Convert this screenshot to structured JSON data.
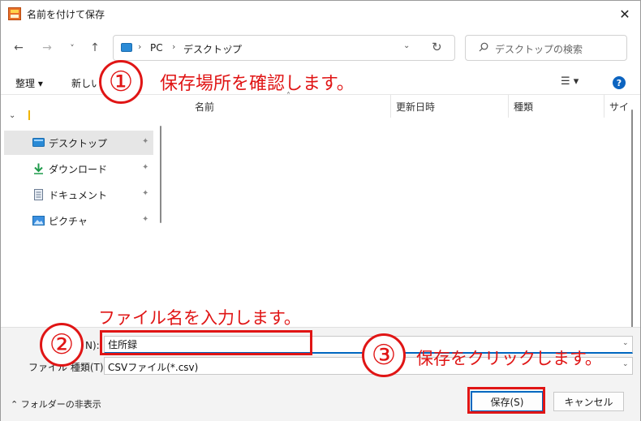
{
  "window": {
    "title": "名前を付けて保存",
    "close_glyph": "✕"
  },
  "nav": {
    "back_glyph": "←",
    "forward_glyph": "→",
    "recent_glyph": "˅",
    "up_glyph": "↑",
    "address": {
      "sep": "›",
      "crumbs": [
        "PC",
        "デスクトップ"
      ],
      "dropdown_glyph": "⌄",
      "refresh_glyph": "↻"
    },
    "search_placeholder": "デスクトップの検索"
  },
  "commandbar": {
    "organize_label": "整理 ▾",
    "newfolder_label": "新しい",
    "view_glyph": "☰ ▾",
    "help_glyph": "?"
  },
  "navpane": {
    "expand_glyph": "⌄",
    "pin_glyph": "📌",
    "items": [
      {
        "label": "デスクトップ",
        "icon": "desktop-icon"
      },
      {
        "label": "ダウンロード",
        "icon": "download-icon"
      },
      {
        "label": "ドキュメント",
        "icon": "document-icon"
      },
      {
        "label": "ピクチャ",
        "icon": "picture-icon"
      }
    ]
  },
  "filelist": {
    "sort_glyph": "˄",
    "columns": [
      "名前",
      "更新日時",
      "種類",
      "サイ"
    ]
  },
  "form": {
    "filename_label": "N):",
    "filename_value": "住所録",
    "filetype_label": "ファイル 種類(T):",
    "filetype_value": "CSVファイル(*.csv)",
    "dropdown_glyph": "⌄",
    "hide_folders_label": "⌃ フォルダーの非表示",
    "save_label": "保存(S)",
    "cancel_label": "キャンセル"
  },
  "annotations": {
    "step1_number": "①",
    "step1_text": "保存場所を確認します。",
    "step2_number": "②",
    "step2_text": "ファイル名を入力します。",
    "step3_number": "③",
    "step3_text": "保存をクリックします。",
    "color": "#e01515"
  }
}
